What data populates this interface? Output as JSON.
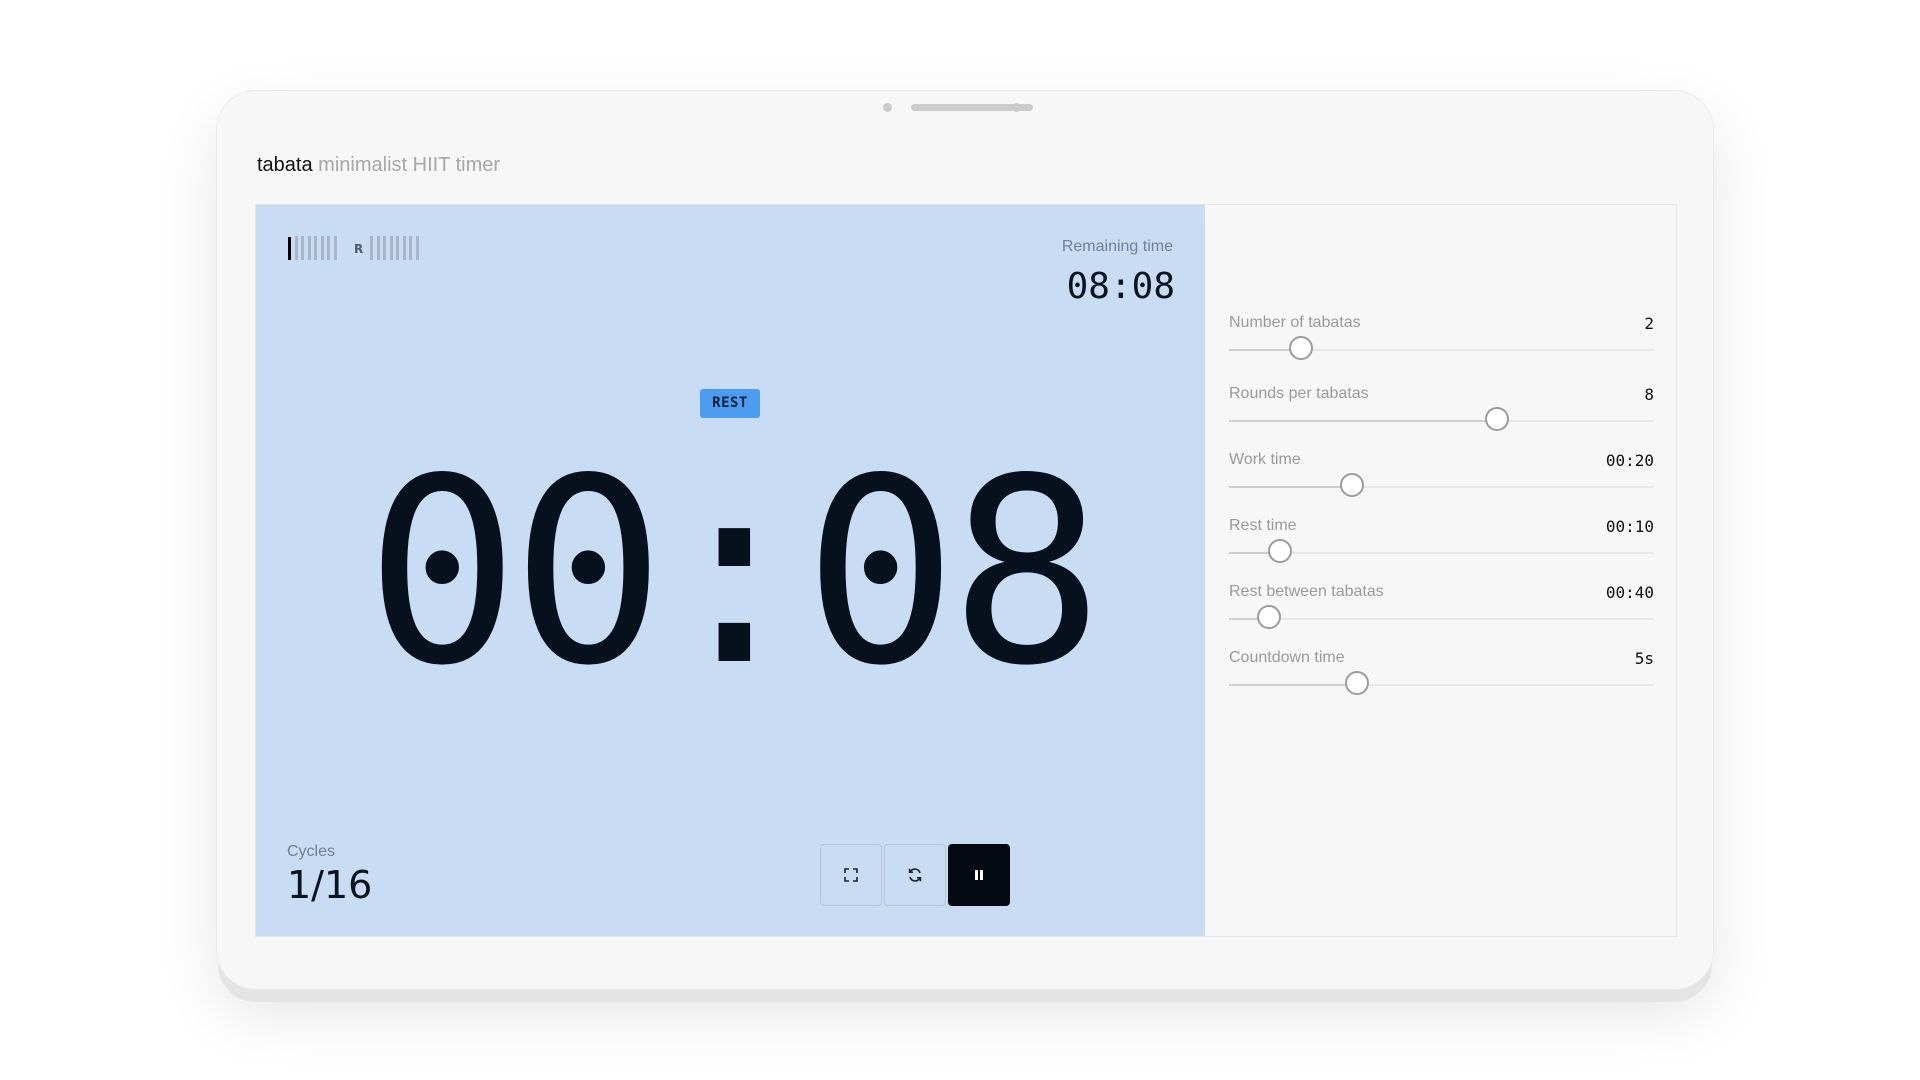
{
  "app": {
    "name": "tabata",
    "subtitle": "minimalist HIIT timer"
  },
  "timer": {
    "remaining_label": "Remaining time",
    "remaining_value": "08:08",
    "phase": "REST",
    "current_time": "00:08",
    "cycles_label": "Cycles",
    "cycles_value": "1/16",
    "rounds_total": 16,
    "rounds_completed": 1,
    "rest_marker": "R"
  },
  "controls": {
    "fullscreen_icon": "fullscreen-icon",
    "reset_icon": "reset-icon",
    "pause_icon": "pause-icon"
  },
  "settings": [
    {
      "label": "Number of tabatas",
      "value": "2",
      "level": 0.17
    },
    {
      "label": "Rounds per tabatas",
      "value": "8",
      "level": 0.63
    },
    {
      "label": "Work time",
      "value": "00:20",
      "level": 0.29
    },
    {
      "label": "Rest time",
      "value": "00:10",
      "level": 0.12
    },
    {
      "label": "Rest between tabatas",
      "value": "00:40",
      "level": 0.095
    },
    {
      "label": "Countdown time",
      "value": "5s",
      "level": 0.3
    }
  ],
  "colors": {
    "timer_background": "#c8dcf4",
    "badge": "#4c9df0",
    "primary_button": "#050a12"
  }
}
